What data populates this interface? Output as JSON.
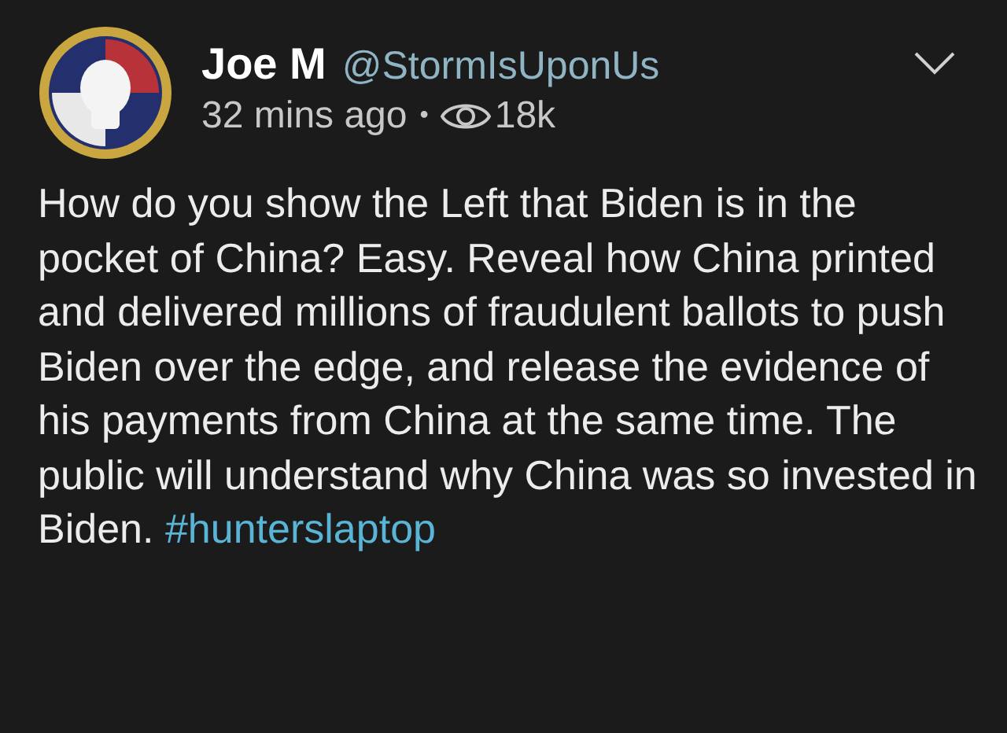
{
  "post": {
    "author": "Joe M",
    "handle": "@StormIsUponUs",
    "time": "32 mins ago",
    "separator": "•",
    "views": "18k",
    "body": "How do you show the Left that Biden is in the pocket of China? Easy. Reveal how China printed and delivered millions of fraudulent ballots to push Biden over the edge, and release the evidence of his payments from China at the same time. The public will understand why China was so invested in Biden.",
    "hashtag": "#hunterslaptop"
  }
}
